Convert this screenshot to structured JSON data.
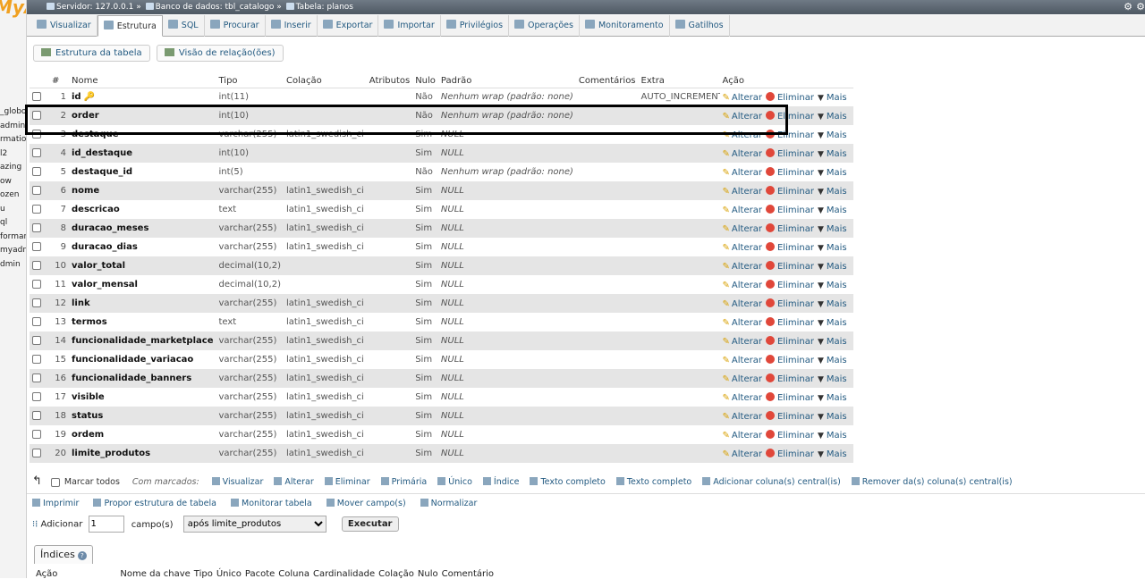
{
  "topbar": {
    "logo": "MyA",
    "server": "Servidor: 127.0.0.1",
    "database": "Banco de dados: tbl_catalogo",
    "table": "Tabela: planos"
  },
  "leftnav": [
    "_globo",
    "admin",
    "rmation",
    "l2",
    "azing",
    "ow",
    "ozen",
    "u",
    "ql",
    "forman",
    "myadn",
    "dmin"
  ],
  "tabs": [
    {
      "label": "Visualizar"
    },
    {
      "label": "Estrutura",
      "active": true
    },
    {
      "label": "SQL"
    },
    {
      "label": "Procurar"
    },
    {
      "label": "Inserir"
    },
    {
      "label": "Exportar"
    },
    {
      "label": "Importar"
    },
    {
      "label": "Privilégios"
    },
    {
      "label": "Operações"
    },
    {
      "label": "Monitoramento"
    },
    {
      "label": "Gatilhos"
    }
  ],
  "subtabs": [
    "Estrutura da tabela",
    "Visão de relação(ões)"
  ],
  "columns": [
    "#",
    "Nome",
    "Tipo",
    "Colação",
    "Atributos",
    "Nulo",
    "Padrão",
    "Comentários",
    "Extra",
    "Ação"
  ],
  "actions": {
    "alter": "Alterar",
    "drop": "Eliminar",
    "more": "Mais"
  },
  "rows": [
    {
      "n": "1",
      "name": "id",
      "type": "int(11)",
      "coll": "",
      "null": "Não",
      "def": "Nenhum wrap (padrão: none)",
      "extra": "AUTO_INCREMENT",
      "key": true
    },
    {
      "n": "2",
      "name": "order",
      "type": "int(10)",
      "coll": "",
      "null": "Não",
      "def": "Nenhum wrap (padrão: none)",
      "extra": ""
    },
    {
      "n": "3",
      "name": "destaque",
      "type": "varchar(255)",
      "coll": "latin1_swedish_ci",
      "null": "Sim",
      "def": "NULL",
      "extra": ""
    },
    {
      "n": "4",
      "name": "id_destaque",
      "type": "int(10)",
      "coll": "",
      "null": "Sim",
      "def": "NULL",
      "extra": ""
    },
    {
      "n": "5",
      "name": "destaque_id",
      "type": "int(5)",
      "coll": "",
      "null": "Não",
      "def": "Nenhum wrap (padrão: none)",
      "extra": ""
    },
    {
      "n": "6",
      "name": "nome",
      "type": "varchar(255)",
      "coll": "latin1_swedish_ci",
      "null": "Sim",
      "def": "NULL",
      "extra": ""
    },
    {
      "n": "7",
      "name": "descricao",
      "type": "text",
      "coll": "latin1_swedish_ci",
      "null": "Sim",
      "def": "NULL",
      "extra": ""
    },
    {
      "n": "8",
      "name": "duracao_meses",
      "type": "varchar(255)",
      "coll": "latin1_swedish_ci",
      "null": "Sim",
      "def": "NULL",
      "extra": ""
    },
    {
      "n": "9",
      "name": "duracao_dias",
      "type": "varchar(255)",
      "coll": "latin1_swedish_ci",
      "null": "Sim",
      "def": "NULL",
      "extra": ""
    },
    {
      "n": "10",
      "name": "valor_total",
      "type": "decimal(10,2)",
      "coll": "",
      "null": "Sim",
      "def": "NULL",
      "extra": ""
    },
    {
      "n": "11",
      "name": "valor_mensal",
      "type": "decimal(10,2)",
      "coll": "",
      "null": "Sim",
      "def": "NULL",
      "extra": ""
    },
    {
      "n": "12",
      "name": "link",
      "type": "varchar(255)",
      "coll": "latin1_swedish_ci",
      "null": "Sim",
      "def": "NULL",
      "extra": ""
    },
    {
      "n": "13",
      "name": "termos",
      "type": "text",
      "coll": "latin1_swedish_ci",
      "null": "Sim",
      "def": "NULL",
      "extra": ""
    },
    {
      "n": "14",
      "name": "funcionalidade_marketplace",
      "type": "varchar(255)",
      "coll": "latin1_swedish_ci",
      "null": "Sim",
      "def": "NULL",
      "extra": ""
    },
    {
      "n": "15",
      "name": "funcionalidade_variacao",
      "type": "varchar(255)",
      "coll": "latin1_swedish_ci",
      "null": "Sim",
      "def": "NULL",
      "extra": ""
    },
    {
      "n": "16",
      "name": "funcionalidade_banners",
      "type": "varchar(255)",
      "coll": "latin1_swedish_ci",
      "null": "Sim",
      "def": "NULL",
      "extra": ""
    },
    {
      "n": "17",
      "name": "visible",
      "type": "varchar(255)",
      "coll": "latin1_swedish_ci",
      "null": "Sim",
      "def": "NULL",
      "extra": ""
    },
    {
      "n": "18",
      "name": "status",
      "type": "varchar(255)",
      "coll": "latin1_swedish_ci",
      "null": "Sim",
      "def": "NULL",
      "extra": ""
    },
    {
      "n": "19",
      "name": "ordem",
      "type": "varchar(255)",
      "coll": "latin1_swedish_ci",
      "null": "Sim",
      "def": "NULL",
      "extra": ""
    },
    {
      "n": "20",
      "name": "limite_produtos",
      "type": "varchar(255)",
      "coll": "latin1_swedish_ci",
      "null": "Sim",
      "def": "NULL",
      "extra": ""
    }
  ],
  "bulk": {
    "check_all": "Marcar todos",
    "with_selected": "Com marcados:",
    "items": [
      "Visualizar",
      "Alterar",
      "Eliminar",
      "Primária",
      "Único",
      "Índice",
      "Texto completo",
      "Texto completo",
      "Adicionar coluna(s) central(is)",
      "Remover da(s) coluna(s) central(is)"
    ]
  },
  "links": [
    "Imprimir",
    "Propor estrutura de tabela",
    "Monitorar tabela",
    "Mover campo(s)",
    "Normalizar"
  ],
  "addrow": {
    "label": "Adicionar",
    "count": "1",
    "fields": "campo(s)",
    "position": "após limite_produtos",
    "go": "Executar"
  },
  "indexes": {
    "title": "Índices",
    "headers": [
      "Ação",
      "Nome da chave",
      "Tipo",
      "Único",
      "Pacote",
      "Coluna",
      "Cardinalidade",
      "Colação",
      "Nulo",
      "Comentário"
    ]
  }
}
